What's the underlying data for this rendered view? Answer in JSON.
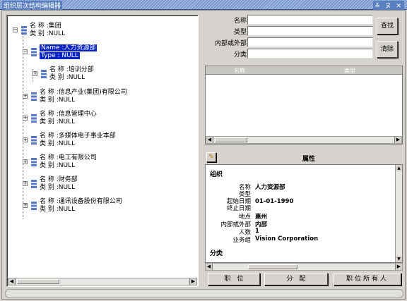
{
  "window": {
    "title": "组织层次结构编辑器",
    "controls": "≚ ヌ ✕"
  },
  "tree": {
    "nodes": [
      {
        "label": "名 称 :集团",
        "sub": "类 别 :NULL"
      },
      {
        "label": "Name :人力资源部",
        "sub": "Type : NULL"
      },
      {
        "label": "名 称 :培训分部",
        "sub": "类 别 :NULL"
      },
      {
        "label": "名 称 :信息产业(集团)有限公司",
        "sub": "类 别 :NULL"
      },
      {
        "label": "名 称 :信息管理中心",
        "sub": "类 别 :NULL"
      },
      {
        "label": "名 称 :多媒体电子事业本部",
        "sub": "类 别 :NULL"
      },
      {
        "label": "名 称 :电工有限公司",
        "sub": "类 别 :NULL"
      },
      {
        "label": "名 称 :财务部",
        "sub": "类 别 :NULL"
      },
      {
        "label": "名 称 :通讯设备股份有限公司",
        "sub": "类 别 :NULL"
      }
    ]
  },
  "search": {
    "name_label": "名称",
    "type_label": "类型",
    "inout_label": "内部或外部",
    "category_label": "分类",
    "find_button": "查找",
    "clear_button": "清除"
  },
  "results": {
    "columns": [
      "名称",
      "类型"
    ]
  },
  "properties": {
    "title": "属性",
    "section1": "组织",
    "rows": [
      {
        "key": "名称",
        "value": "人力资源部"
      },
      {
        "key": "类型",
        "value": ""
      },
      {
        "key": "起始日期",
        "value": "01-01-1990"
      },
      {
        "key": "终止日期",
        "value": ""
      },
      {
        "key": "地点",
        "value": "惠州"
      },
      {
        "key": "内部或外部",
        "value": "内部"
      },
      {
        "key": "人数",
        "value": "1"
      },
      {
        "key": "业务组",
        "value": "Vision Corporation"
      }
    ],
    "section2": "分类"
  },
  "buttons": {
    "positions": "职　位",
    "assign": "分　配",
    "all_positions": "职位所有人"
  }
}
